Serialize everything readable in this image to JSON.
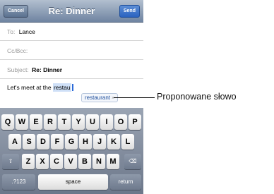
{
  "nav": {
    "cancel": "Cancel",
    "title": "Re: Dinner",
    "send": "Send"
  },
  "fields": {
    "to_label": "To:",
    "to_value": "Lance",
    "ccbcc_label": "Cc/Bcc:",
    "subject_label": "Subject:",
    "subject_value": "Re: Dinner"
  },
  "message": {
    "prefix": "Let's meet at the ",
    "typed": "restau"
  },
  "suggestion": {
    "word": "restaurant",
    "close": "×"
  },
  "keyboard": {
    "row1": [
      "Q",
      "W",
      "E",
      "R",
      "T",
      "Y",
      "U",
      "I",
      "O",
      "P"
    ],
    "row2": [
      "A",
      "S",
      "D",
      "F",
      "G",
      "H",
      "J",
      "K",
      "L"
    ],
    "row3": [
      "Z",
      "X",
      "C",
      "V",
      "B",
      "N",
      "M"
    ],
    "shift": "⇧",
    "delete": "⌫",
    "numbers": ".?123",
    "space": "space",
    "return": "return"
  },
  "callout": {
    "label": "Proponowane słowo"
  }
}
